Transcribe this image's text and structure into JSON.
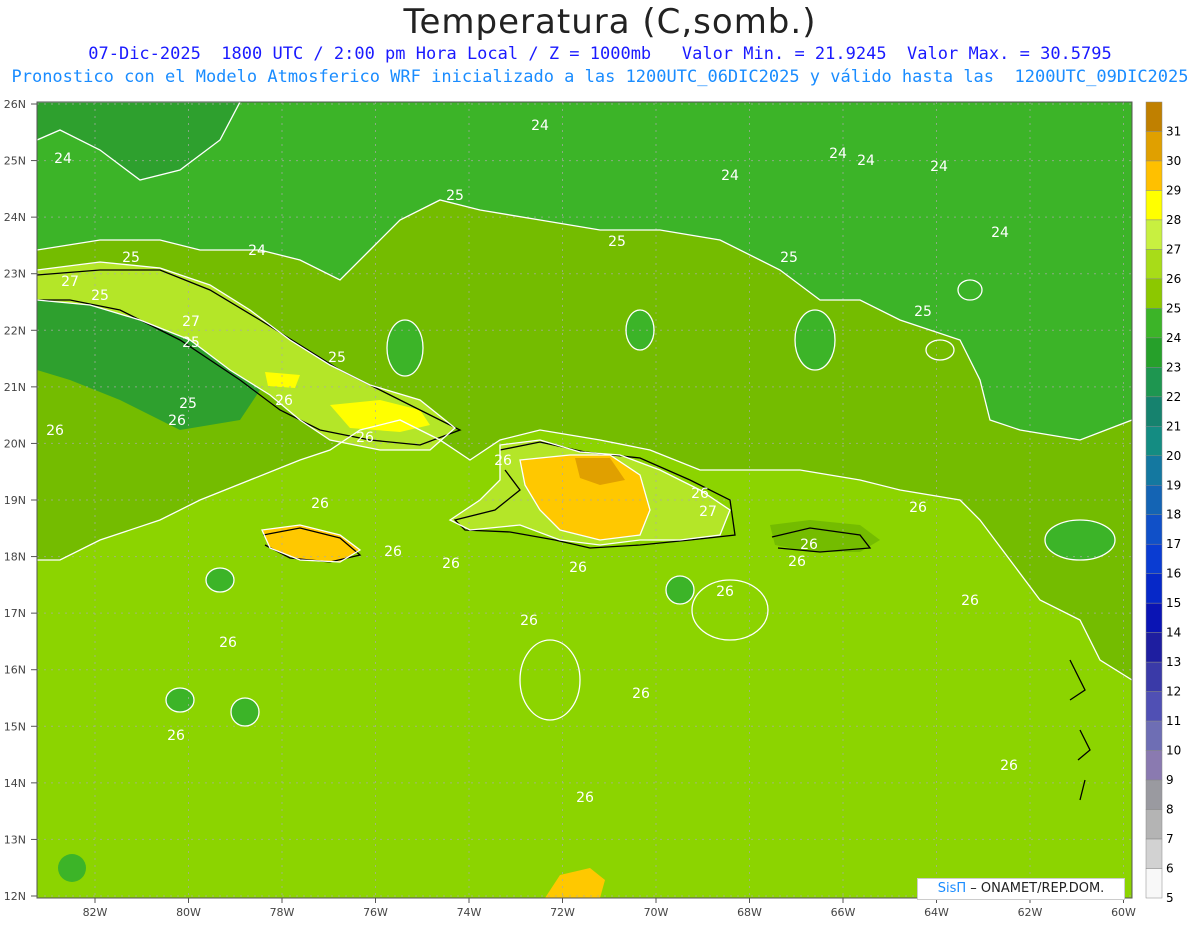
{
  "header": {
    "title": "Temperatura (C,somb.)",
    "subtitle1": "07-Dic-2025  1800 UTC / 2:00 pm Hora Local / Z = 1000mb   Valor Min. = 21.9245  Valor Max. = 30.5795",
    "subtitle2": "Pronostico con el Modelo Atmosferico WRF inicializado a las 1200UTC_06DIC2025 y válido hasta las  1200UTC_09DIC2025"
  },
  "credit": {
    "logo": "SisΠ",
    "text": "ONAMET/REP.DOM."
  },
  "map": {
    "lat_labels": [
      "26N",
      "25N",
      "24N",
      "23N",
      "22N",
      "21N",
      "20N",
      "19N",
      "18N",
      "17N",
      "16N",
      "15N",
      "14N",
      "13N",
      "12N"
    ],
    "lon_labels": [
      "82W",
      "80W",
      "78W",
      "76W",
      "74W",
      "72W",
      "70W",
      "68W",
      "66W",
      "64W",
      "62W",
      "60W"
    ],
    "contour_labels": [
      {
        "text": "24"
      },
      {
        "text": "24"
      },
      {
        "text": "24"
      },
      {
        "text": "24"
      },
      {
        "text": "24"
      },
      {
        "text": "24"
      },
      {
        "text": "24"
      },
      {
        "text": "24"
      },
      {
        "text": "25"
      },
      {
        "text": "25"
      },
      {
        "text": "25"
      },
      {
        "text": "25"
      },
      {
        "text": "25"
      },
      {
        "text": "25"
      },
      {
        "text": "25"
      },
      {
        "text": "25"
      },
      {
        "text": "25"
      },
      {
        "text": "27"
      },
      {
        "text": "27"
      },
      {
        "text": "27"
      },
      {
        "text": "26"
      },
      {
        "text": "26"
      },
      {
        "text": "26"
      },
      {
        "text": "26"
      },
      {
        "text": "26"
      },
      {
        "text": "26"
      },
      {
        "text": "26"
      },
      {
        "text": "26"
      },
      {
        "text": "26"
      },
      {
        "text": "26"
      },
      {
        "text": "26"
      },
      {
        "text": "26"
      },
      {
        "text": "26"
      },
      {
        "text": "26"
      },
      {
        "text": "26"
      },
      {
        "text": "26"
      },
      {
        "text": "26"
      },
      {
        "text": "26"
      },
      {
        "text": "26"
      },
      {
        "text": "26"
      },
      {
        "text": "26"
      }
    ]
  },
  "colorbar": {
    "labels": [
      "31",
      "30",
      "29",
      "28",
      "27",
      "26",
      "25",
      "24",
      "23",
      "22",
      "21",
      "20",
      "19",
      "18",
      "17",
      "16",
      "15",
      "14",
      "13",
      "12",
      "11",
      "10",
      "9",
      "8",
      "7",
      "6",
      "5"
    ],
    "colors": [
      "#c08000",
      "#e0a000",
      "#ffc000",
      "#ffff00",
      "#c8f040",
      "#a8dc18",
      "#8cc800",
      "#3cb428",
      "#26a02a",
      "#1e9650",
      "#16826e",
      "#148c82",
      "#1478a0",
      "#1464b4",
      "#1050c8",
      "#0a3cd2",
      "#0628c8",
      "#0a14b4",
      "#1e1ea0",
      "#3a3aa8",
      "#5050b4",
      "#6e6eb4",
      "#8a7ab0",
      "#9a9aa0",
      "#b4b4b4",
      "#d2d2d2",
      "#f8f8f8"
    ]
  }
}
